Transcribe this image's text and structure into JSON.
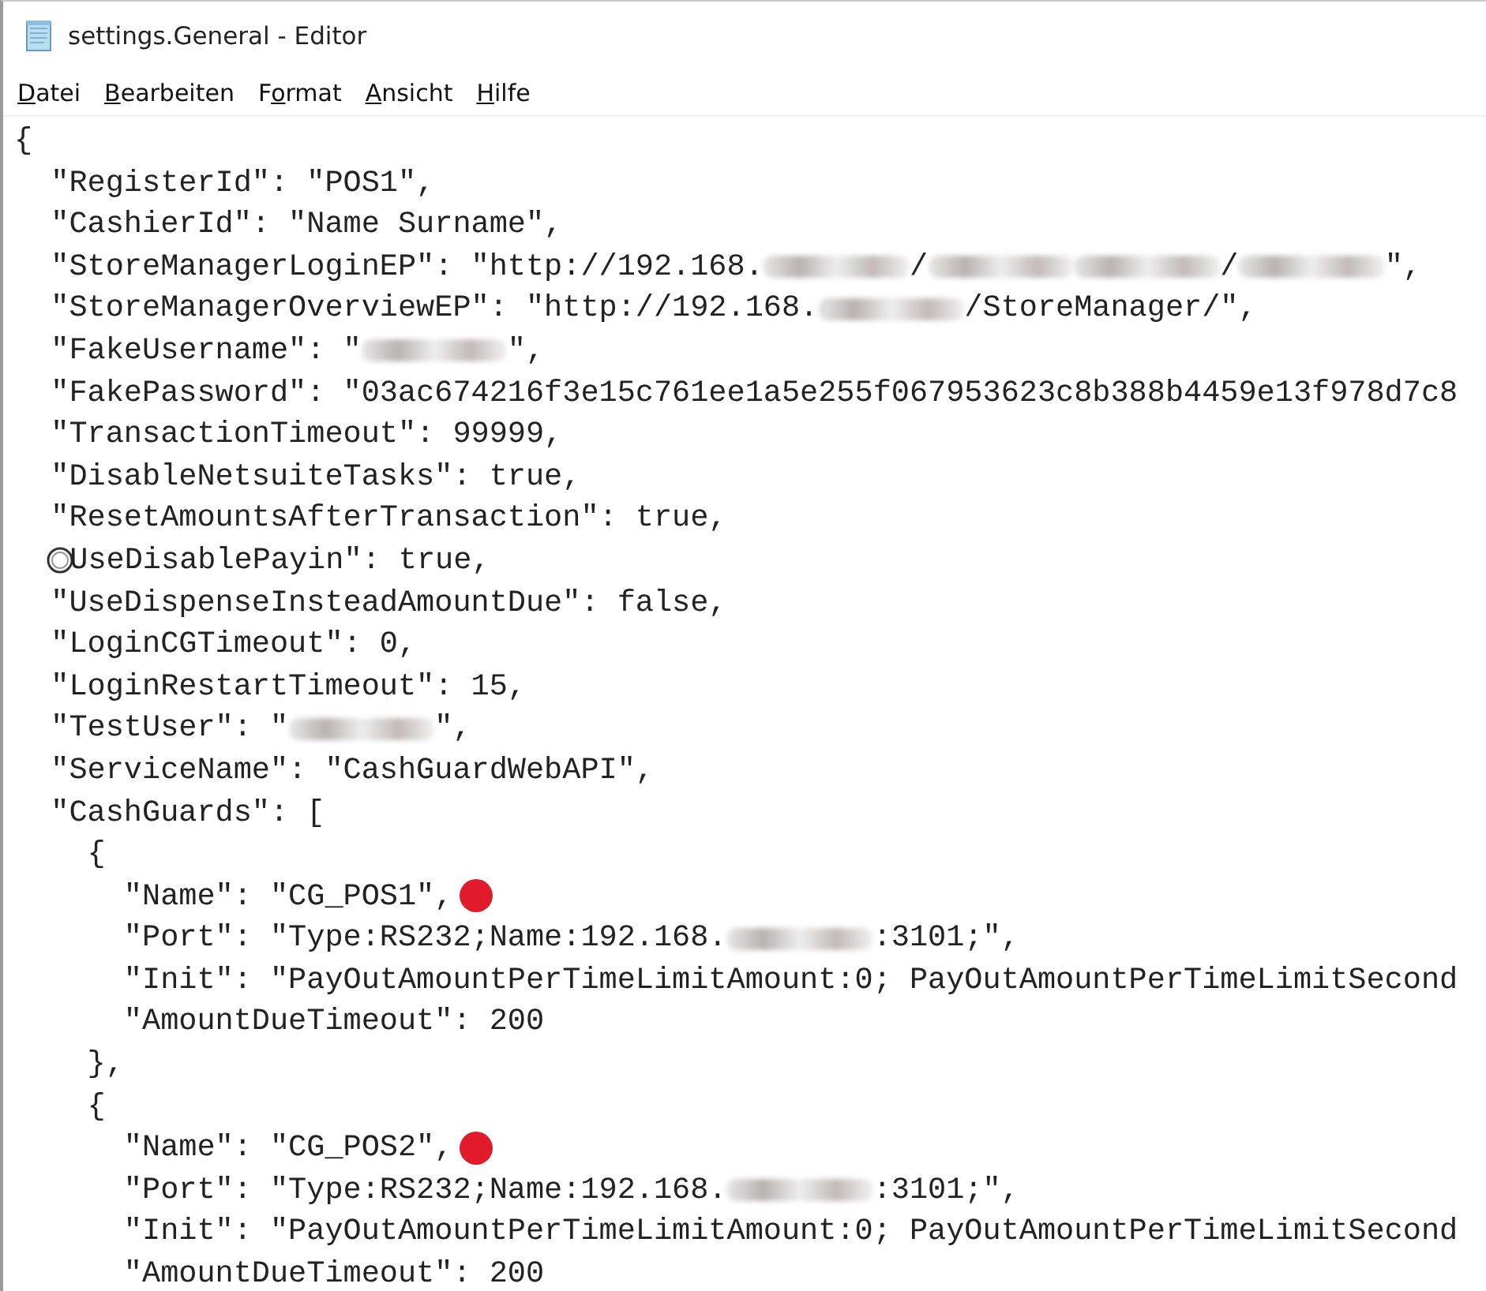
{
  "window": {
    "title": "settings.General - Editor"
  },
  "menu": [
    {
      "key": "D",
      "after": "atei"
    },
    {
      "key": "B",
      "after": "earbeiten"
    },
    {
      "before": "F",
      "key": "o",
      "after": "rmat"
    },
    {
      "key": "A",
      "after": "nsicht"
    },
    {
      "key": "H",
      "after": "ilfe"
    }
  ],
  "lines": [
    [
      {
        "kind": "text",
        "text": "{"
      }
    ],
    [
      {
        "kind": "text",
        "text": "  \"RegisterId\": \"POS1\","
      }
    ],
    [
      {
        "kind": "text",
        "text": "  \"CashierId\": \"Name Surname\","
      }
    ],
    [
      {
        "kind": "text",
        "text": "  \"StoreManagerLoginEP\": \"http://192.168."
      },
      {
        "kind": "redacted"
      },
      {
        "kind": "text",
        "text": "/"
      },
      {
        "kind": "redacted"
      },
      {
        "kind": "redacted"
      },
      {
        "kind": "text",
        "text": "/"
      },
      {
        "kind": "redacted"
      },
      {
        "kind": "text",
        "text": "\","
      }
    ],
    [
      {
        "kind": "text",
        "text": "  \"StoreManagerOverviewEP\": \"http://192.168."
      },
      {
        "kind": "redacted"
      },
      {
        "kind": "text",
        "text": "/StoreManager/\","
      }
    ],
    [
      {
        "kind": "text",
        "text": "  \"FakeUsername\": \""
      },
      {
        "kind": "redacted"
      },
      {
        "kind": "text",
        "text": "\","
      }
    ],
    [
      {
        "kind": "text",
        "text": "  \"FakePassword\": \"03ac674216f3e15c761ee1a5e255f067953623c8b388b4459e13f978d7c8"
      }
    ],
    [
      {
        "kind": "text",
        "text": "  \"TransactionTimeout\": 99999,"
      }
    ],
    [
      {
        "kind": "text",
        "text": "  \"DisableNetsuiteTasks\": true,"
      }
    ],
    [
      {
        "kind": "text",
        "text": "  \"ResetAmountsAfterTransaction\": true,"
      }
    ],
    [
      {
        "kind": "cursor"
      },
      {
        "kind": "text",
        "text": "UseDisablePayin\": true,"
      }
    ],
    [
      {
        "kind": "text",
        "text": "  \"UseDispenseInsteadAmountDue\": false,"
      }
    ],
    [
      {
        "kind": "text",
        "text": "  \"LoginCGTimeout\": 0,"
      }
    ],
    [
      {
        "kind": "text",
        "text": "  \"LoginRestartTimeout\": 15,"
      }
    ],
    [
      {
        "kind": "text",
        "text": "  \"TestUser\": \""
      },
      {
        "kind": "redacted"
      },
      {
        "kind": "text",
        "text": "\","
      }
    ],
    [
      {
        "kind": "text",
        "text": "  \"ServiceName\": \"CashGuardWebAPI\","
      }
    ],
    [
      {
        "kind": "text",
        "text": "  \"CashGuards\": ["
      }
    ],
    [
      {
        "kind": "text",
        "text": "    {"
      }
    ],
    [
      {
        "kind": "text",
        "text": "      \"Name\": \"CG_POS1\","
      },
      {
        "kind": "dot"
      }
    ],
    [
      {
        "kind": "text",
        "text": "      \"Port\": \"Type:RS232;Name:192.168."
      },
      {
        "kind": "redacted"
      },
      {
        "kind": "text",
        "text": ":3101;\","
      }
    ],
    [
      {
        "kind": "text",
        "text": "      \"Init\": \"PayOutAmountPerTimeLimitAmount:0; PayOutAmountPerTimeLimitSecond"
      }
    ],
    [
      {
        "kind": "text",
        "text": "      \"AmountDueTimeout\": 200"
      }
    ],
    [
      {
        "kind": "text",
        "text": "    },"
      }
    ],
    [
      {
        "kind": "text",
        "text": "    {"
      }
    ],
    [
      {
        "kind": "text",
        "text": "      \"Name\": \"CG_POS2\","
      },
      {
        "kind": "dot"
      }
    ],
    [
      {
        "kind": "text",
        "text": "      \"Port\": \"Type:RS232;Name:192.168."
      },
      {
        "kind": "redacted"
      },
      {
        "kind": "text",
        "text": ":3101;\","
      }
    ],
    [
      {
        "kind": "text",
        "text": "      \"Init\": \"PayOutAmountPerTimeLimitAmount:0; PayOutAmountPerTimeLimitSecond"
      }
    ],
    [
      {
        "kind": "text",
        "text": "      \"AmountDueTimeout\": 200"
      }
    ]
  ]
}
